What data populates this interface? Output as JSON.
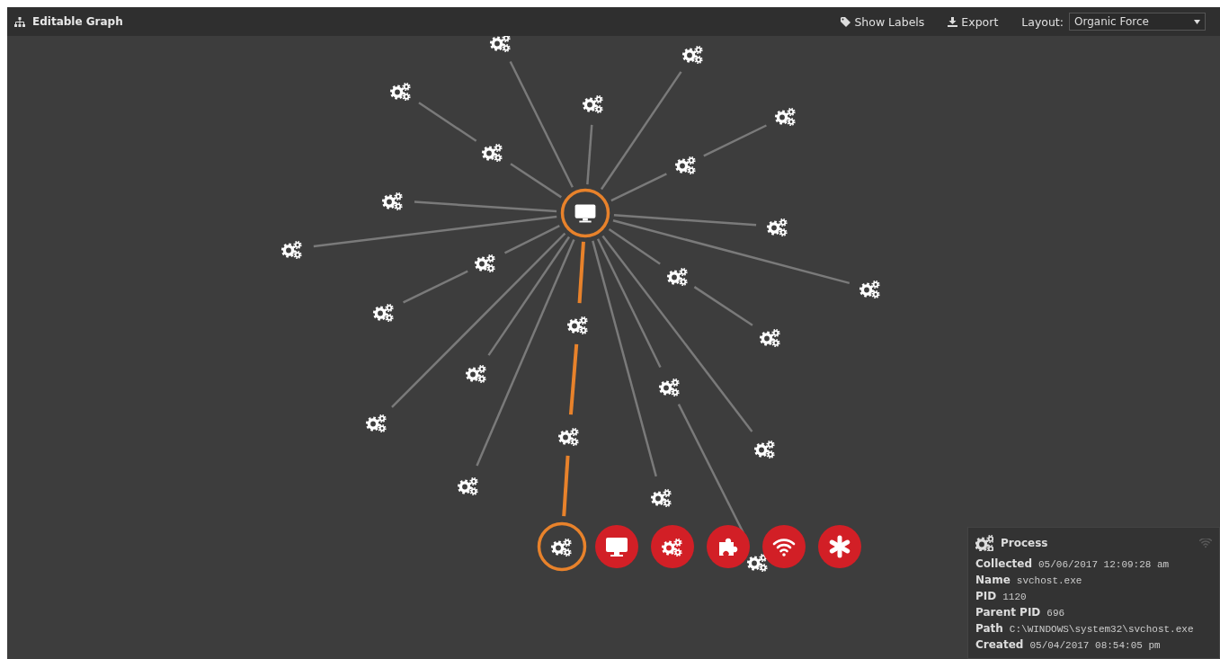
{
  "app_bar": {
    "title": "Editable Graph",
    "actions": [
      {
        "kind": "tag",
        "label": "Show Labels"
      },
      {
        "kind": "download",
        "label": "Export"
      }
    ],
    "layout": {
      "label": "Layout:",
      "value": "Organic Force"
    }
  },
  "graph": {
    "nodes": [
      {
        "kind": "computer",
        "selected": true
      },
      {
        "kind": "process",
        "selected": false
      },
      {
        "kind": "process",
        "selected": false
      },
      {
        "kind": "process",
        "selected": false
      },
      {
        "kind": "process",
        "selected": false
      },
      {
        "kind": "process",
        "selected": false
      },
      {
        "kind": "process",
        "selected": false
      },
      {
        "kind": "process",
        "selected": false
      },
      {
        "kind": "process",
        "selected": false
      },
      {
        "kind": "process",
        "selected": false
      },
      {
        "kind": "process",
        "selected": false
      },
      {
        "kind": "process",
        "selected": false
      },
      {
        "kind": "process",
        "selected": false
      },
      {
        "kind": "process",
        "selected": false
      },
      {
        "kind": "process",
        "selected": false
      },
      {
        "kind": "process",
        "selected": false
      },
      {
        "kind": "process",
        "selected": false
      },
      {
        "kind": "process",
        "selected": false
      },
      {
        "kind": "process",
        "selected": false
      },
      {
        "kind": "process",
        "selected": false
      },
      {
        "kind": "process",
        "selected": false
      },
      {
        "kind": "process",
        "selected": false
      },
      {
        "kind": "process",
        "selected": false
      },
      {
        "kind": "process",
        "selected": false
      },
      {
        "kind": "process",
        "selected": true
      },
      {
        "kind": "process",
        "selected": false
      }
    ],
    "edges": [
      {
        "highlighted": false
      },
      {
        "highlighted": false
      },
      {
        "highlighted": false
      },
      {
        "highlighted": false
      },
      {
        "highlighted": false
      },
      {
        "highlighted": false
      },
      {
        "highlighted": false
      },
      {
        "highlighted": false
      },
      {
        "highlighted": false
      },
      {
        "highlighted": false
      },
      {
        "highlighted": false
      },
      {
        "highlighted": false
      },
      {
        "highlighted": false
      },
      {
        "highlighted": false
      },
      {
        "highlighted": true
      },
      {
        "highlighted": false
      },
      {
        "highlighted": false
      },
      {
        "highlighted": false
      },
      {
        "highlighted": false
      },
      {
        "highlighted": true
      },
      {
        "highlighted": false
      },
      {
        "highlighted": false
      },
      {
        "highlighted": false
      },
      {
        "highlighted": true
      },
      {
        "highlighted": false
      }
    ]
  },
  "action_menu": [
    {
      "kind": "computer"
    },
    {
      "kind": "process"
    },
    {
      "kind": "plugin"
    },
    {
      "kind": "network"
    },
    {
      "kind": "other"
    }
  ],
  "details": {
    "title": "Process",
    "fields": [
      {
        "label": "Collected",
        "value": "05/06/2017 12:09:28 am"
      },
      {
        "label": "Name",
        "value": "svchost.exe"
      },
      {
        "label": "PID",
        "value": "1120"
      },
      {
        "label": "Parent PID",
        "value": "696"
      },
      {
        "label": "Path",
        "value": "C:\\WINDOWS\\system32\\svchost.exe"
      },
      {
        "label": "Created",
        "value": "05/04/2017 08:54:05 pm"
      }
    ]
  }
}
